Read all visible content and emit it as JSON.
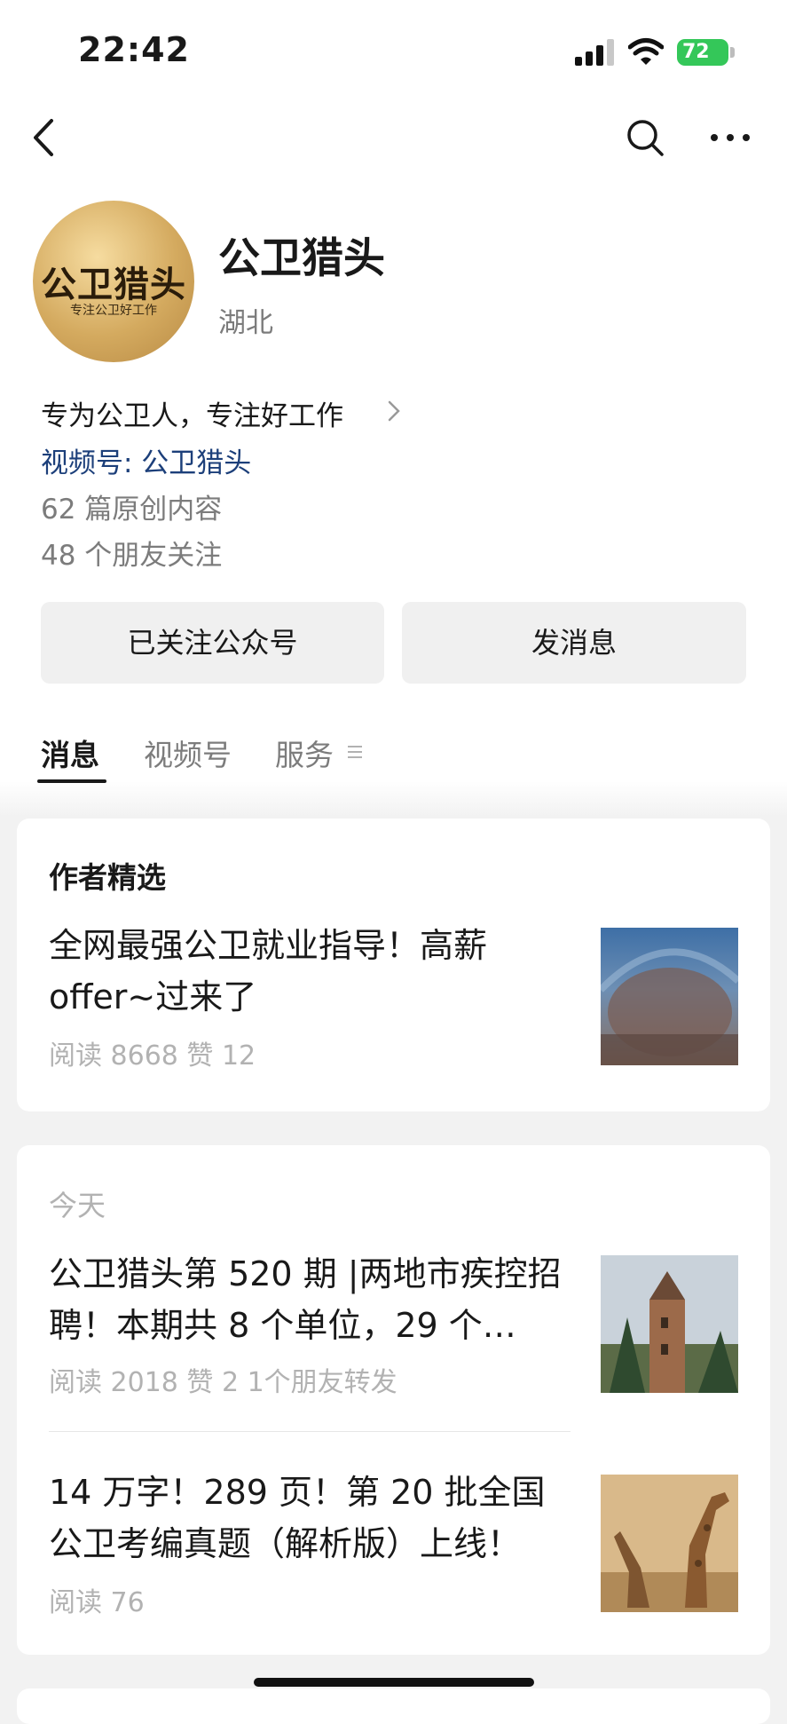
{
  "status_bar": {
    "time": "22:42",
    "battery": "72"
  },
  "profile": {
    "avatar_text_big": "公卫猎头",
    "avatar_text_small": "专注公卫好工作",
    "name": "公卫猎头",
    "region": "湖北",
    "description": "专为公卫人，专注好工作",
    "channel": "视频号: 公卫猎头",
    "original_count": "62 篇原创内容",
    "friends_following": "48 个朋友关注"
  },
  "buttons": {
    "followed": "已关注公众号",
    "message": "发消息"
  },
  "tabs": [
    {
      "label": "消息",
      "active": true
    },
    {
      "label": "视频号",
      "active": false
    },
    {
      "label": "服务",
      "active": false
    }
  ],
  "featured": {
    "header": "作者精选",
    "article": {
      "title": "全网最强公卫就业指导！高薪offer~过来了",
      "meta": "阅读 8668  赞 12"
    }
  },
  "today": {
    "label": "今天",
    "articles": [
      {
        "title": "公卫猎头第 520 期 |两地市疾控招聘！本期共 8 个单位，29 个…",
        "meta": "阅读 2018  赞 2  1个朋友转发"
      },
      {
        "title": "14 万字！289 页！第 20 批全国公卫考编真题（解析版）上线！",
        "meta": "阅读 76"
      }
    ]
  }
}
